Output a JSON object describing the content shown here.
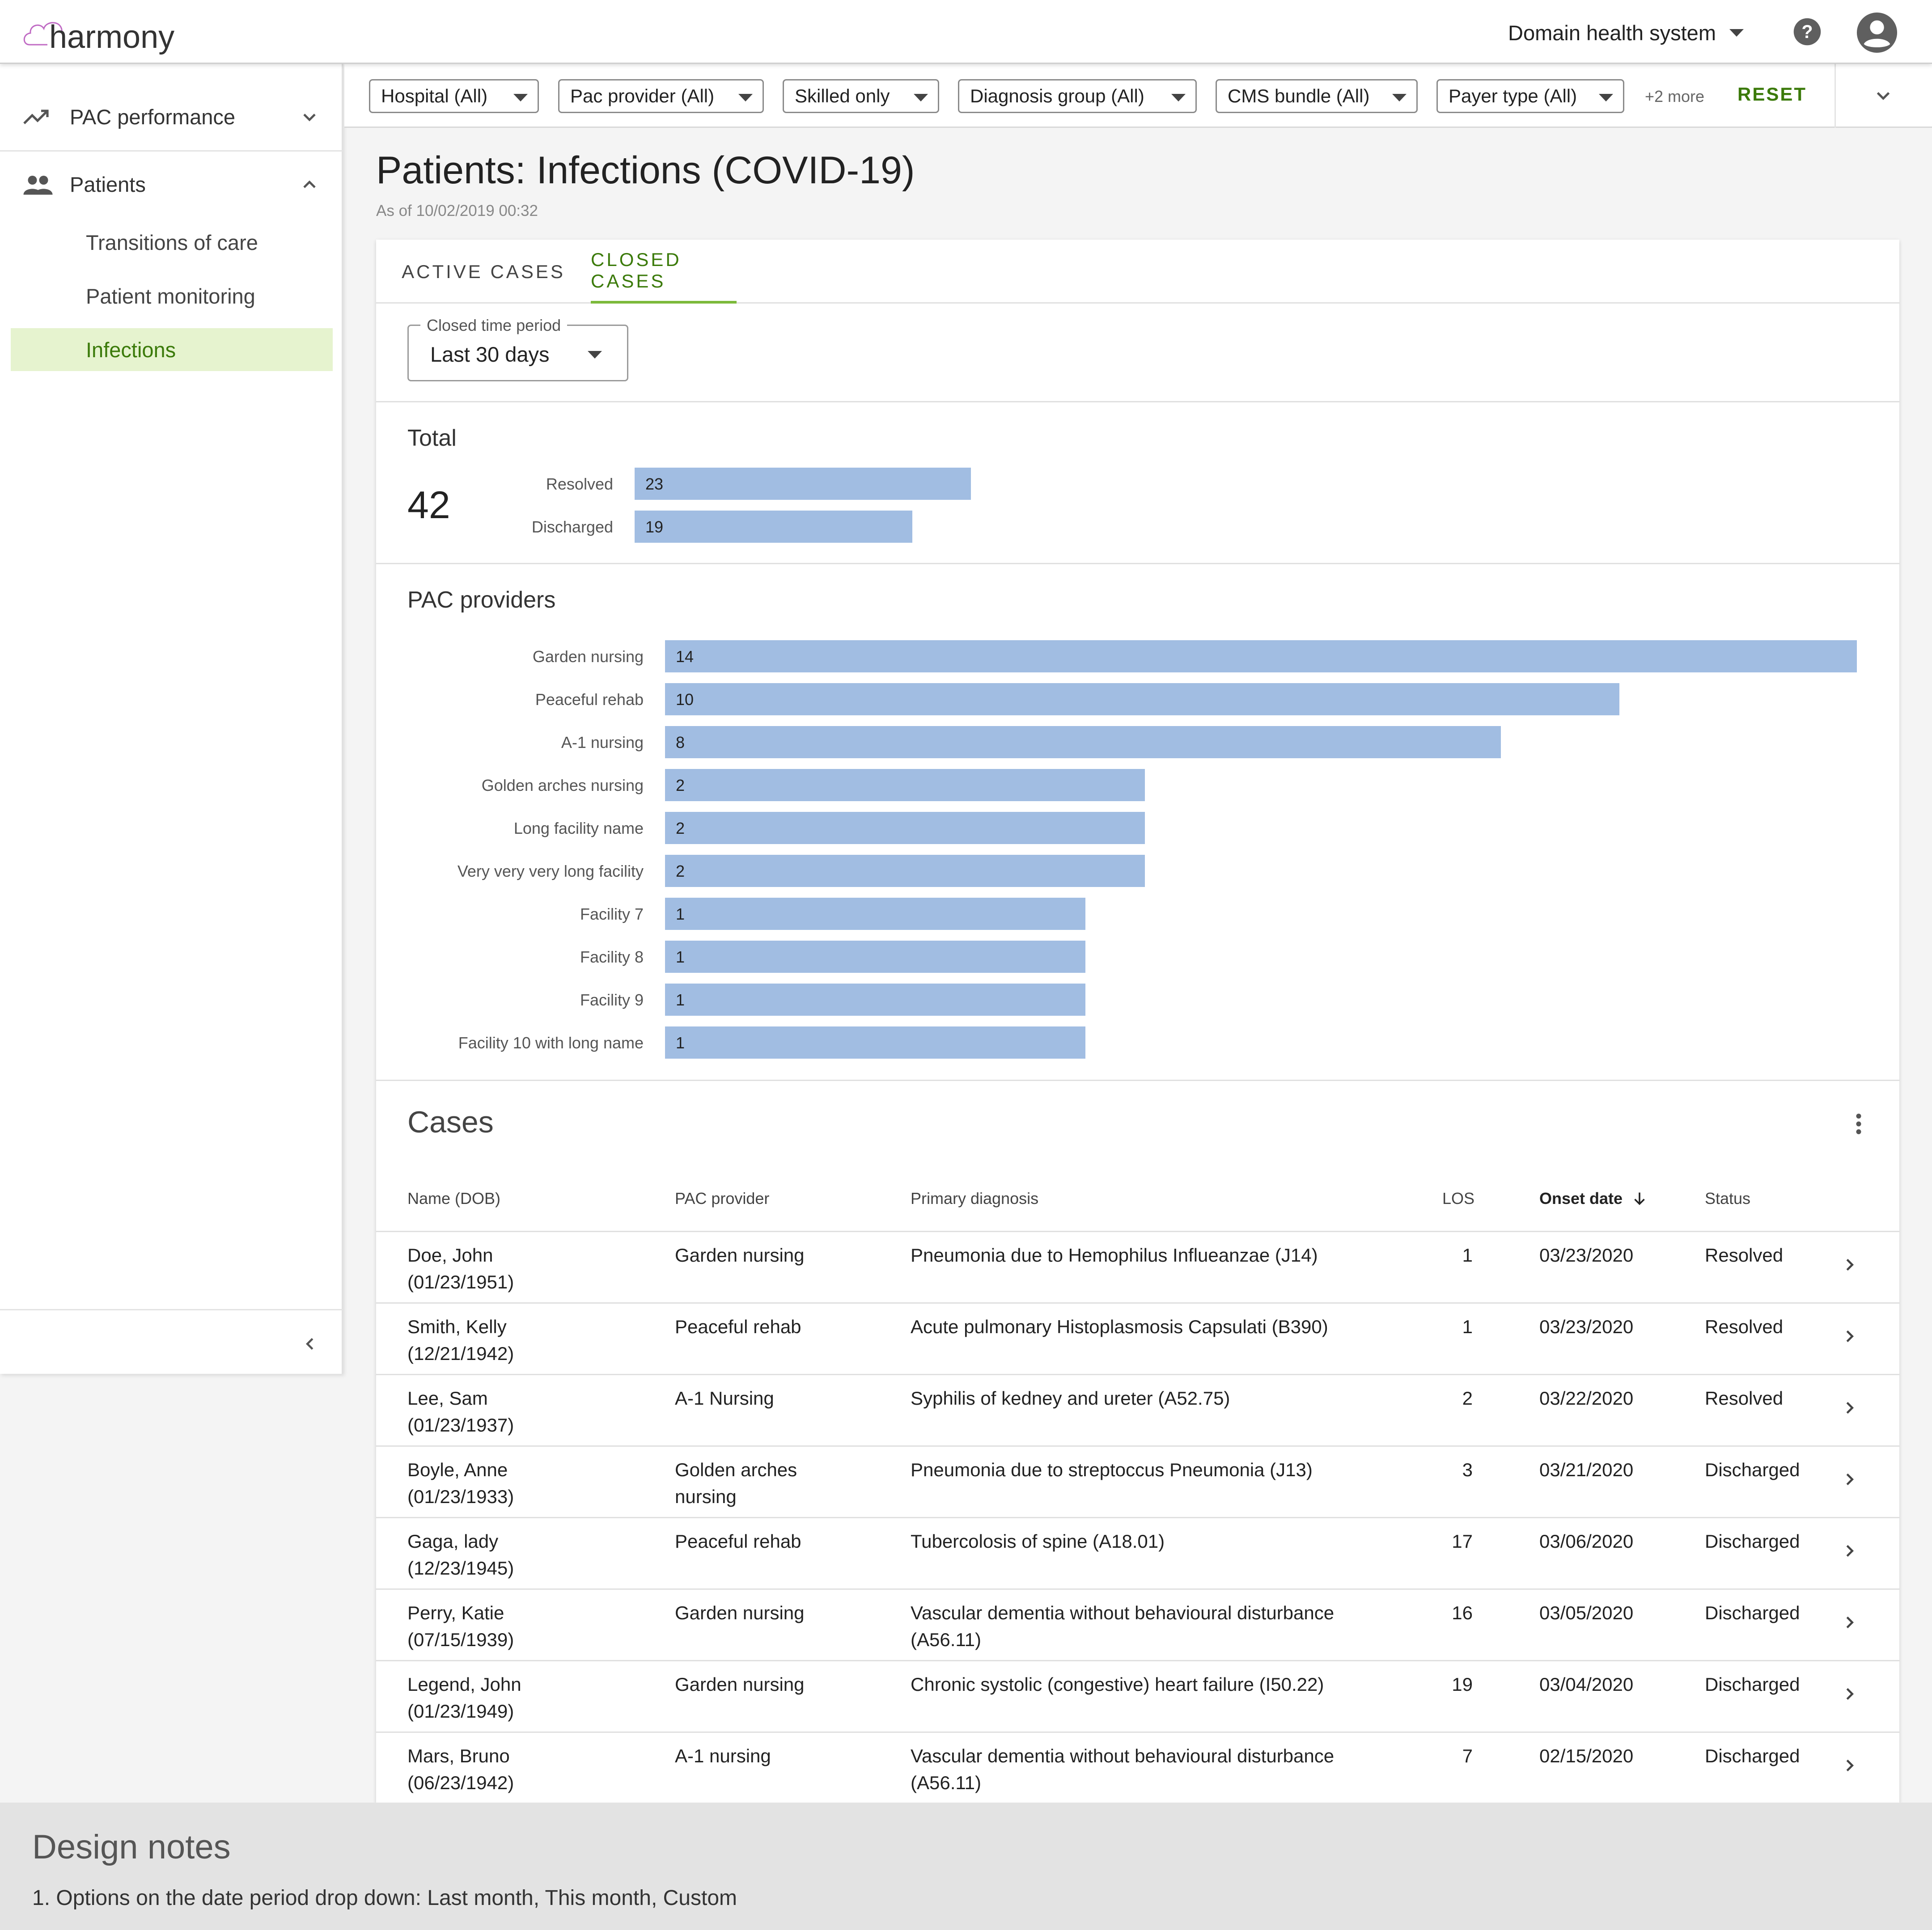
{
  "app": {
    "logo_text": "harmony",
    "organization": "Domain health system"
  },
  "sidebar": {
    "sections": [
      {
        "label": "PAC performance",
        "icon": "trending-up-icon",
        "expanded": false
      },
      {
        "label": "Patients",
        "icon": "people-icon",
        "expanded": true
      }
    ],
    "items": [
      {
        "label": "Transitions of care",
        "active": false
      },
      {
        "label": "Patient monitoring",
        "active": false
      },
      {
        "label": "Infections",
        "active": true
      }
    ]
  },
  "filters": {
    "chips": [
      {
        "label": "Hospital (All)"
      },
      {
        "label": "Pac provider (All)"
      },
      {
        "label": "Skilled only"
      },
      {
        "label": "Diagnosis group (All)"
      },
      {
        "label": "CMS bundle (All)"
      },
      {
        "label": "Payer type (All)"
      }
    ],
    "more": "+2 more",
    "reset": "RESET"
  },
  "page": {
    "title": "Patients: Infections (COVID-19)",
    "as_of": "As of 10/02/2019 00:32"
  },
  "tabs": [
    {
      "label": "ACTIVE CASES",
      "active": false
    },
    {
      "label": "CLOSED CASES",
      "active": true
    }
  ],
  "period": {
    "legend": "Closed time period",
    "value": "Last 30 days"
  },
  "total": {
    "title": "Total",
    "value": "42"
  },
  "providers_title": "PAC providers",
  "chart_data": [
    {
      "type": "bar",
      "orientation": "horizontal",
      "title": "Total",
      "categories": [
        "Resolved",
        "Discharged"
      ],
      "values": [
        23,
        19
      ],
      "color": "#a1bde2"
    },
    {
      "type": "bar",
      "orientation": "horizontal",
      "title": "PAC providers",
      "categories": [
        "Garden nursing",
        "Peaceful rehab",
        "A-1 nursing",
        "Golden arches nursing",
        "Long facility name",
        "Very very very long facility",
        "Facility 7",
        "Facility 8",
        "Facility 9",
        "Facility 10 with long name"
      ],
      "values": [
        14,
        10,
        8,
        2,
        2,
        2,
        1,
        1,
        1,
        1
      ],
      "color": "#a1bde2"
    }
  ],
  "cases": {
    "title": "Cases",
    "columns": [
      "Name (DOB)",
      "PAC provider",
      "Primary diagnosis",
      "LOS",
      "Onset date",
      "Status"
    ],
    "rows": [
      {
        "name": "Doe, John",
        "dob": "(01/23/1951)",
        "provider": "Garden nursing",
        "provider2": "",
        "diagnosis": "Pneumonia due to Hemophilus Influeanzae (J14)",
        "diagnosis2": "",
        "los": "1",
        "onset": "03/23/2020",
        "status": "Resolved"
      },
      {
        "name": "Smith, Kelly",
        "dob": "(12/21/1942)",
        "provider": "Peaceful rehab",
        "provider2": "",
        "diagnosis": "Acute pulmonary Histoplasmosis Capsulati (B390)",
        "diagnosis2": "",
        "los": "1",
        "onset": "03/23/2020",
        "status": "Resolved"
      },
      {
        "name": "Lee, Sam",
        "dob": "(01/23/1937)",
        "provider": "A-1 Nursing",
        "provider2": "",
        "diagnosis": "Syphilis of kedney and ureter (A52.75)",
        "diagnosis2": "",
        "los": "2",
        "onset": "03/22/2020",
        "status": "Resolved"
      },
      {
        "name": "Boyle, Anne",
        "dob": "(01/23/1933)",
        "provider": "Golden arches",
        "provider2": "nursing",
        "diagnosis": "Pneumonia due to streptoccus Pneumonia (J13)",
        "diagnosis2": "",
        "los": "3",
        "onset": "03/21/2020",
        "status": "Discharged"
      },
      {
        "name": "Gaga, lady",
        "dob": "(12/23/1945)",
        "provider": "Peaceful rehab",
        "provider2": "",
        "diagnosis": "Tubercolosis of spine (A18.01)",
        "diagnosis2": "",
        "los": "17",
        "onset": "03/06/2020",
        "status": "Discharged"
      },
      {
        "name": "Perry, Katie",
        "dob": "(07/15/1939)",
        "provider": "Garden nursing",
        "provider2": "",
        "diagnosis": "Vascular dementia without behavioural disturbance",
        "diagnosis2": "(A56.11)",
        "los": "16",
        "onset": "03/05/2020",
        "status": "Discharged"
      },
      {
        "name": "Legend, John",
        "dob": "(01/23/1949)",
        "provider": "Garden nursing",
        "provider2": "",
        "diagnosis": "Chronic systolic (congestive) heart failure (I50.22)",
        "diagnosis2": "",
        "los": "19",
        "onset": "03/04/2020",
        "status": "Discharged"
      },
      {
        "name": "Mars, Bruno",
        "dob": "(06/23/1942)",
        "provider": "A-1 nursing",
        "provider2": "",
        "diagnosis": "Vascular dementia without behavioural disturbance",
        "diagnosis2": "(A56.11)",
        "los": "7",
        "onset": "02/15/2020",
        "status": "Discharged"
      }
    ]
  },
  "notes": {
    "title": "Design notes",
    "line1": "1. Options on the date period drop down: Last month, This month, Custom"
  },
  "colors": {
    "accent": "#3b7a0a",
    "active_bg": "#e6f3cf",
    "bar": "#a1bde2"
  }
}
